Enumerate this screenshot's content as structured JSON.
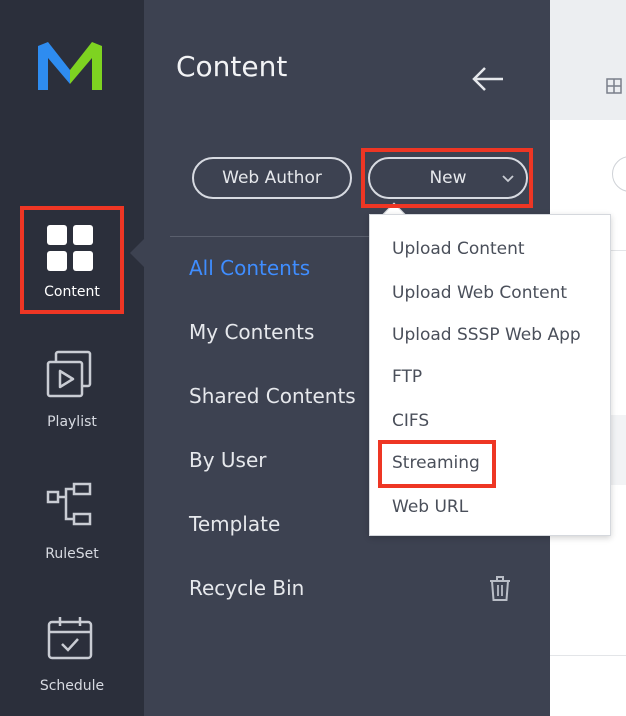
{
  "rail": {
    "items": [
      {
        "label": "Content",
        "icon": "grid-icon",
        "active": true
      },
      {
        "label": "Playlist",
        "icon": "playlist-icon"
      },
      {
        "label": "RuleSet",
        "icon": "ruleset-icon"
      },
      {
        "label": "Schedule",
        "icon": "schedule-icon"
      }
    ]
  },
  "panel": {
    "title": "Content",
    "web_author_label": "Web Author",
    "new_label": "New",
    "nav": [
      {
        "label": "All Contents",
        "active": true
      },
      {
        "label": "My Contents"
      },
      {
        "label": "Shared Contents"
      },
      {
        "label": "By User"
      },
      {
        "label": "Template"
      },
      {
        "label": "Recycle Bin"
      }
    ]
  },
  "dropdown": {
    "items": [
      "Upload Content",
      "Upload Web Content",
      "Upload SSSP Web App",
      "FTP",
      "CIFS",
      "Streaming",
      "Web URL"
    ]
  },
  "colors": {
    "rail_bg": "#2b2f3b",
    "panel_bg": "#3d4251",
    "accent": "#3f8dff",
    "highlight": "#ee3624",
    "logo_blue": "#2e8cf0",
    "logo_green": "#7ed321"
  }
}
